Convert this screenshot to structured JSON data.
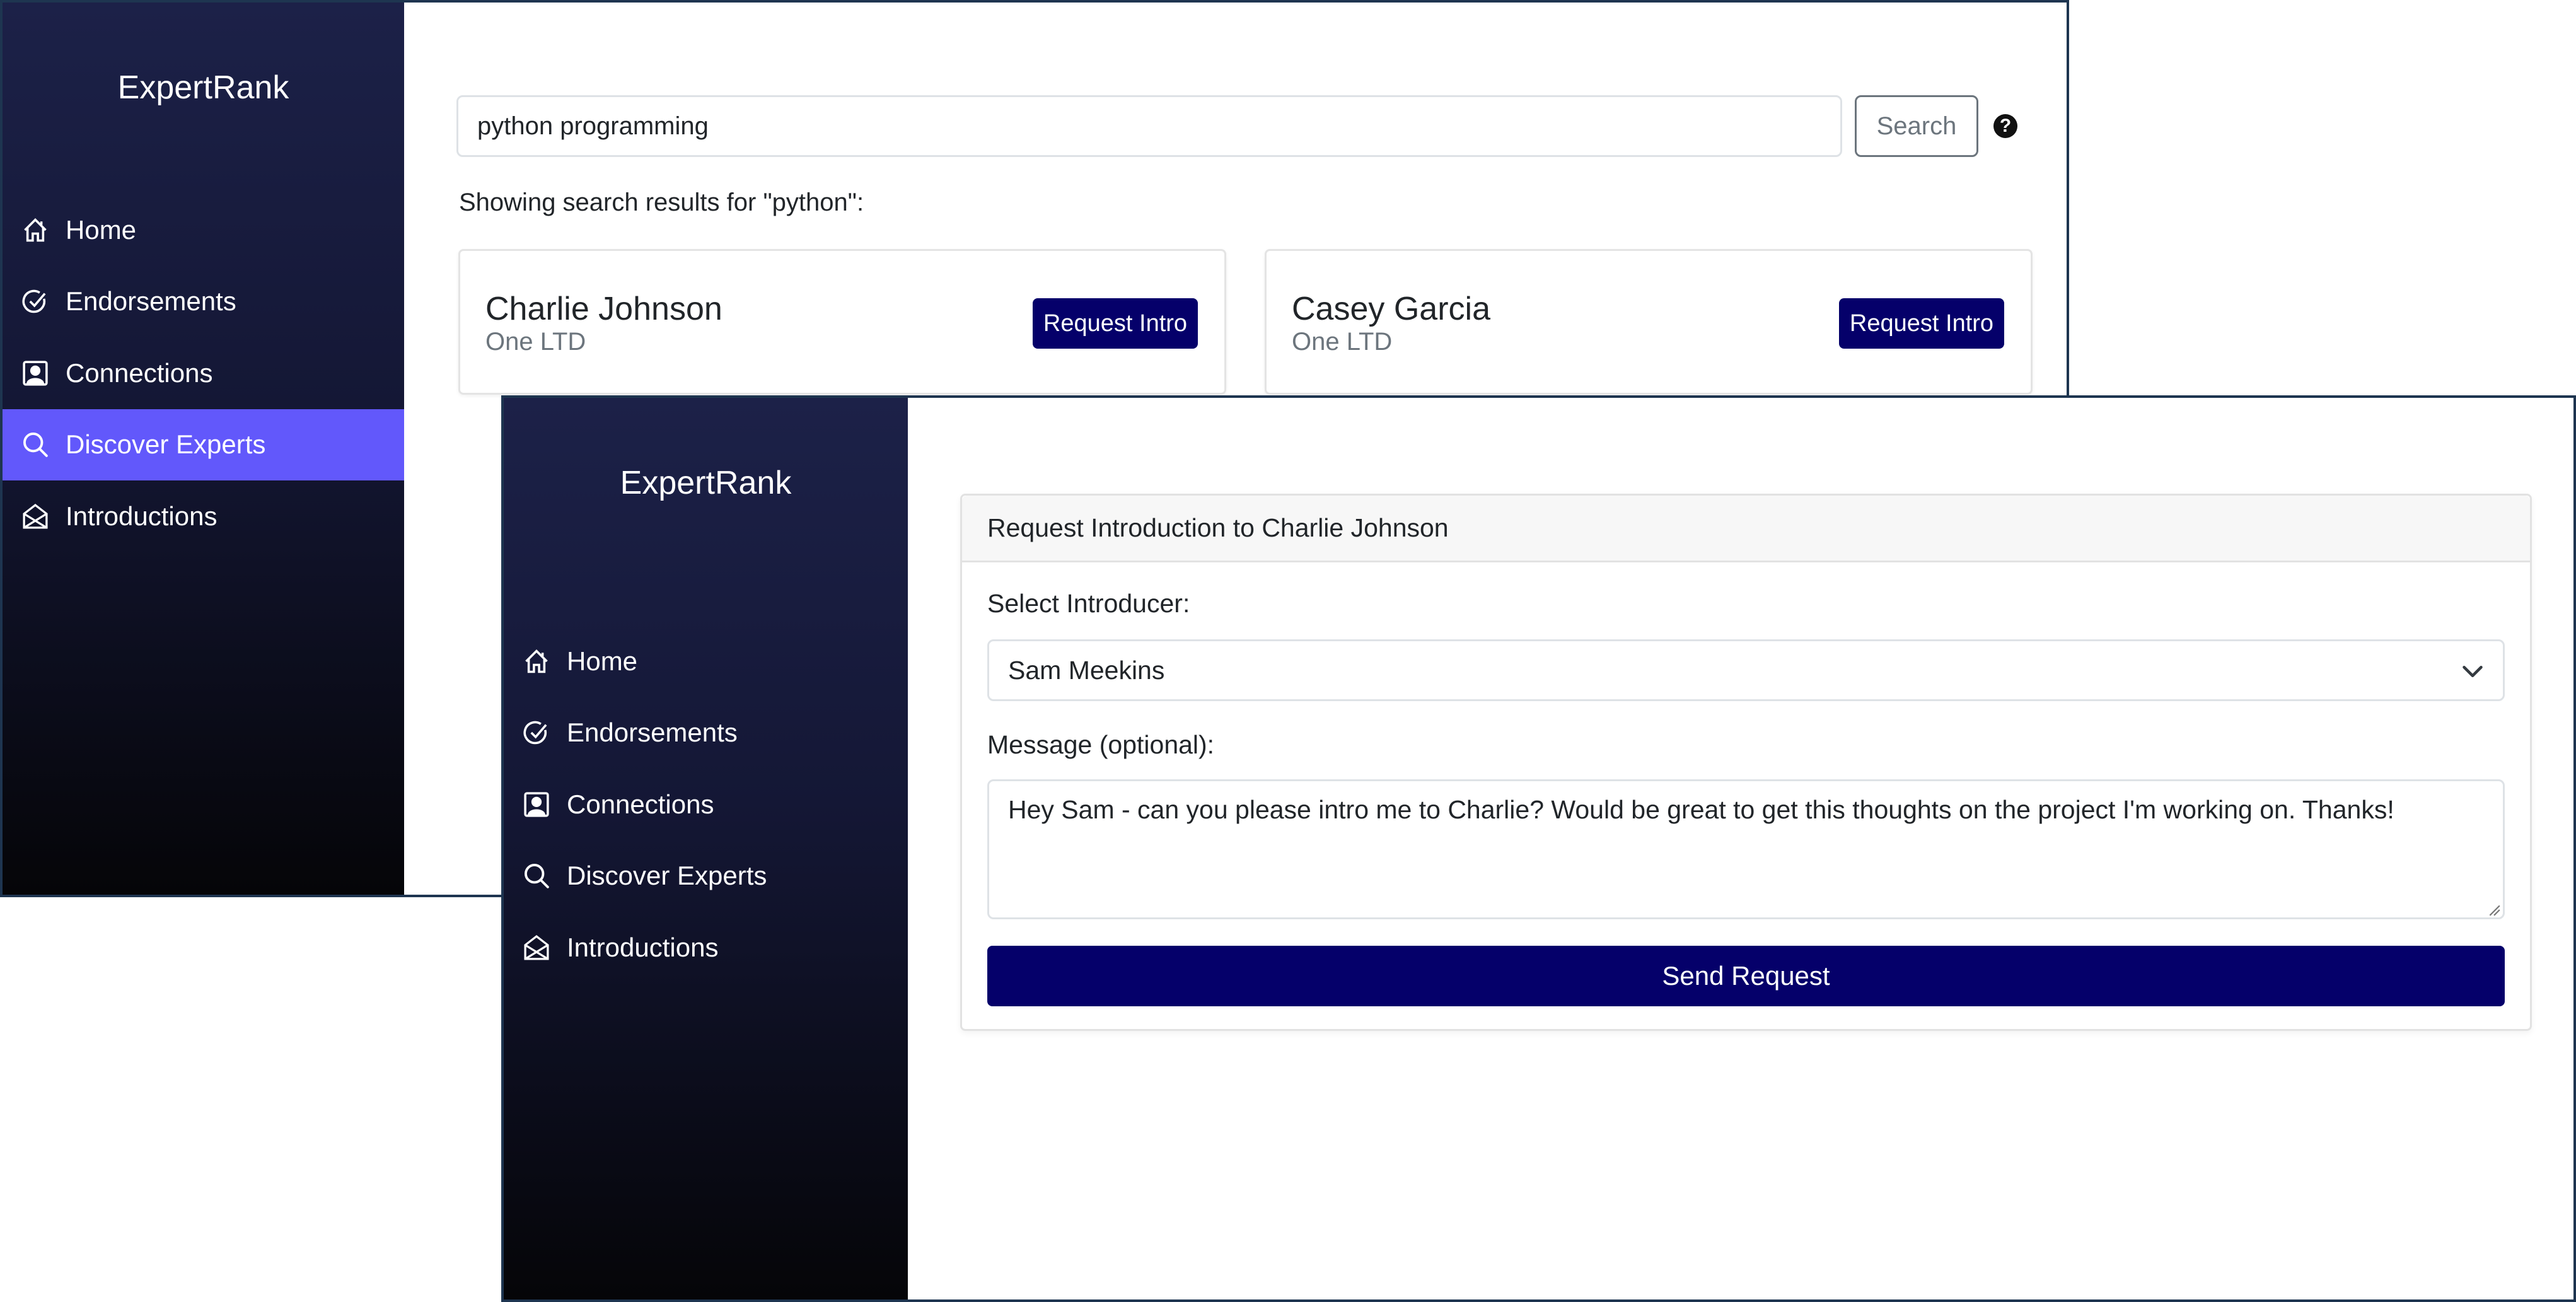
{
  "back_window": {
    "brand": "ExpertRank",
    "nav": [
      {
        "label": "Home",
        "icon": "home-icon"
      },
      {
        "label": "Endorsements",
        "icon": "check-circle-icon"
      },
      {
        "label": "Connections",
        "icon": "person-square-icon"
      },
      {
        "label": "Discover Experts",
        "icon": "search-icon",
        "active": true
      },
      {
        "label": "Introductions",
        "icon": "envelope-open-icon"
      }
    ],
    "search": {
      "value": "python programming",
      "button_label": "Search",
      "help_icon": "?"
    },
    "results_label": "Showing search results for \"python\":",
    "results": [
      {
        "name": "Charlie Johnson",
        "company": "One LTD",
        "button_label": "Request Intro"
      },
      {
        "name": "Casey Garcia",
        "company": "One LTD",
        "button_label": "Request Intro"
      }
    ]
  },
  "front_window": {
    "brand": "ExpertRank",
    "nav": [
      {
        "label": "Home",
        "icon": "home-icon"
      },
      {
        "label": "Endorsements",
        "icon": "check-circle-icon"
      },
      {
        "label": "Connections",
        "icon": "person-square-icon"
      },
      {
        "label": "Discover Experts",
        "icon": "search-icon"
      },
      {
        "label": "Introductions",
        "icon": "envelope-open-icon"
      }
    ],
    "form": {
      "title": "Request Introduction to Charlie Johnson",
      "introducer_label": "Select Introducer:",
      "introducer_value": "Sam Meekins",
      "message_label": "Message (optional):",
      "message_value": "Hey Sam - can you please intro me to Charlie? Would be great to get this thoughts on the project I'm working on. Thanks!",
      "submit_label": "Send Request"
    }
  },
  "colors": {
    "active_nav": "#6258fb",
    "primary_button": "#05006a",
    "sidebar_top": "#1c2148",
    "sidebar_bottom": "#050508",
    "window_border": "#1e3550"
  }
}
